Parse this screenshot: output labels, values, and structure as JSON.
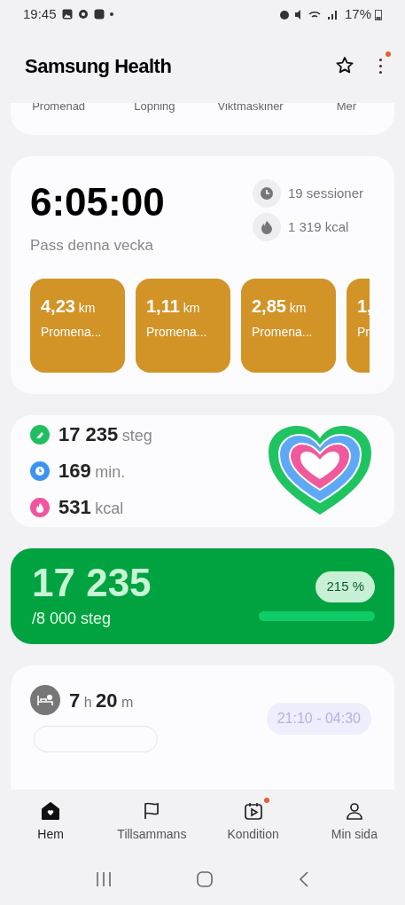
{
  "status_bar": {
    "time": "19:45",
    "battery": "17%"
  },
  "header": {
    "title": "Samsung Health",
    "menu_badge": true
  },
  "shortcuts": [
    "Promenad",
    "Lopning",
    "Viktmaskiner",
    "Mer"
  ],
  "workouts": {
    "total": "6:05:00",
    "caption": "Pass denna vecka",
    "sessions": "19 sessioner",
    "kcal": "1 319 kcal",
    "tiles": [
      {
        "value": "4,23",
        "unit": "km",
        "label": "Promena..."
      },
      {
        "value": "1,11",
        "unit": "km",
        "label": "Promena..."
      },
      {
        "value": "2,85",
        "unit": "km",
        "label": "Promena..."
      },
      {
        "value": "1,",
        "label": "Pr",
        "kind": "partial"
      }
    ]
  },
  "activity": [
    {
      "kind": "steps",
      "value": "17 235",
      "unit": "steg"
    },
    {
      "kind": "minutes",
      "value": "169",
      "unit": "min."
    },
    {
      "kind": "calories",
      "value": "531",
      "unit": "kcal"
    }
  ],
  "steps": {
    "value": "17 235",
    "goal": "/8 000 steg",
    "percent": "215 %",
    "level": 1
  },
  "sleep": {
    "hours": "7",
    "h_unit": "h",
    "minutes": "20",
    "m_unit": "m",
    "range": "21:10 - 04:30"
  },
  "nav": [
    {
      "label": "Hem",
      "selected": true,
      "badge": false
    },
    {
      "label": "Tillsammans",
      "selected": false,
      "badge": false
    },
    {
      "label": "Kondition",
      "selected": false,
      "badge": true
    },
    {
      "label": "Min sida",
      "selected": false,
      "badge": false
    }
  ]
}
